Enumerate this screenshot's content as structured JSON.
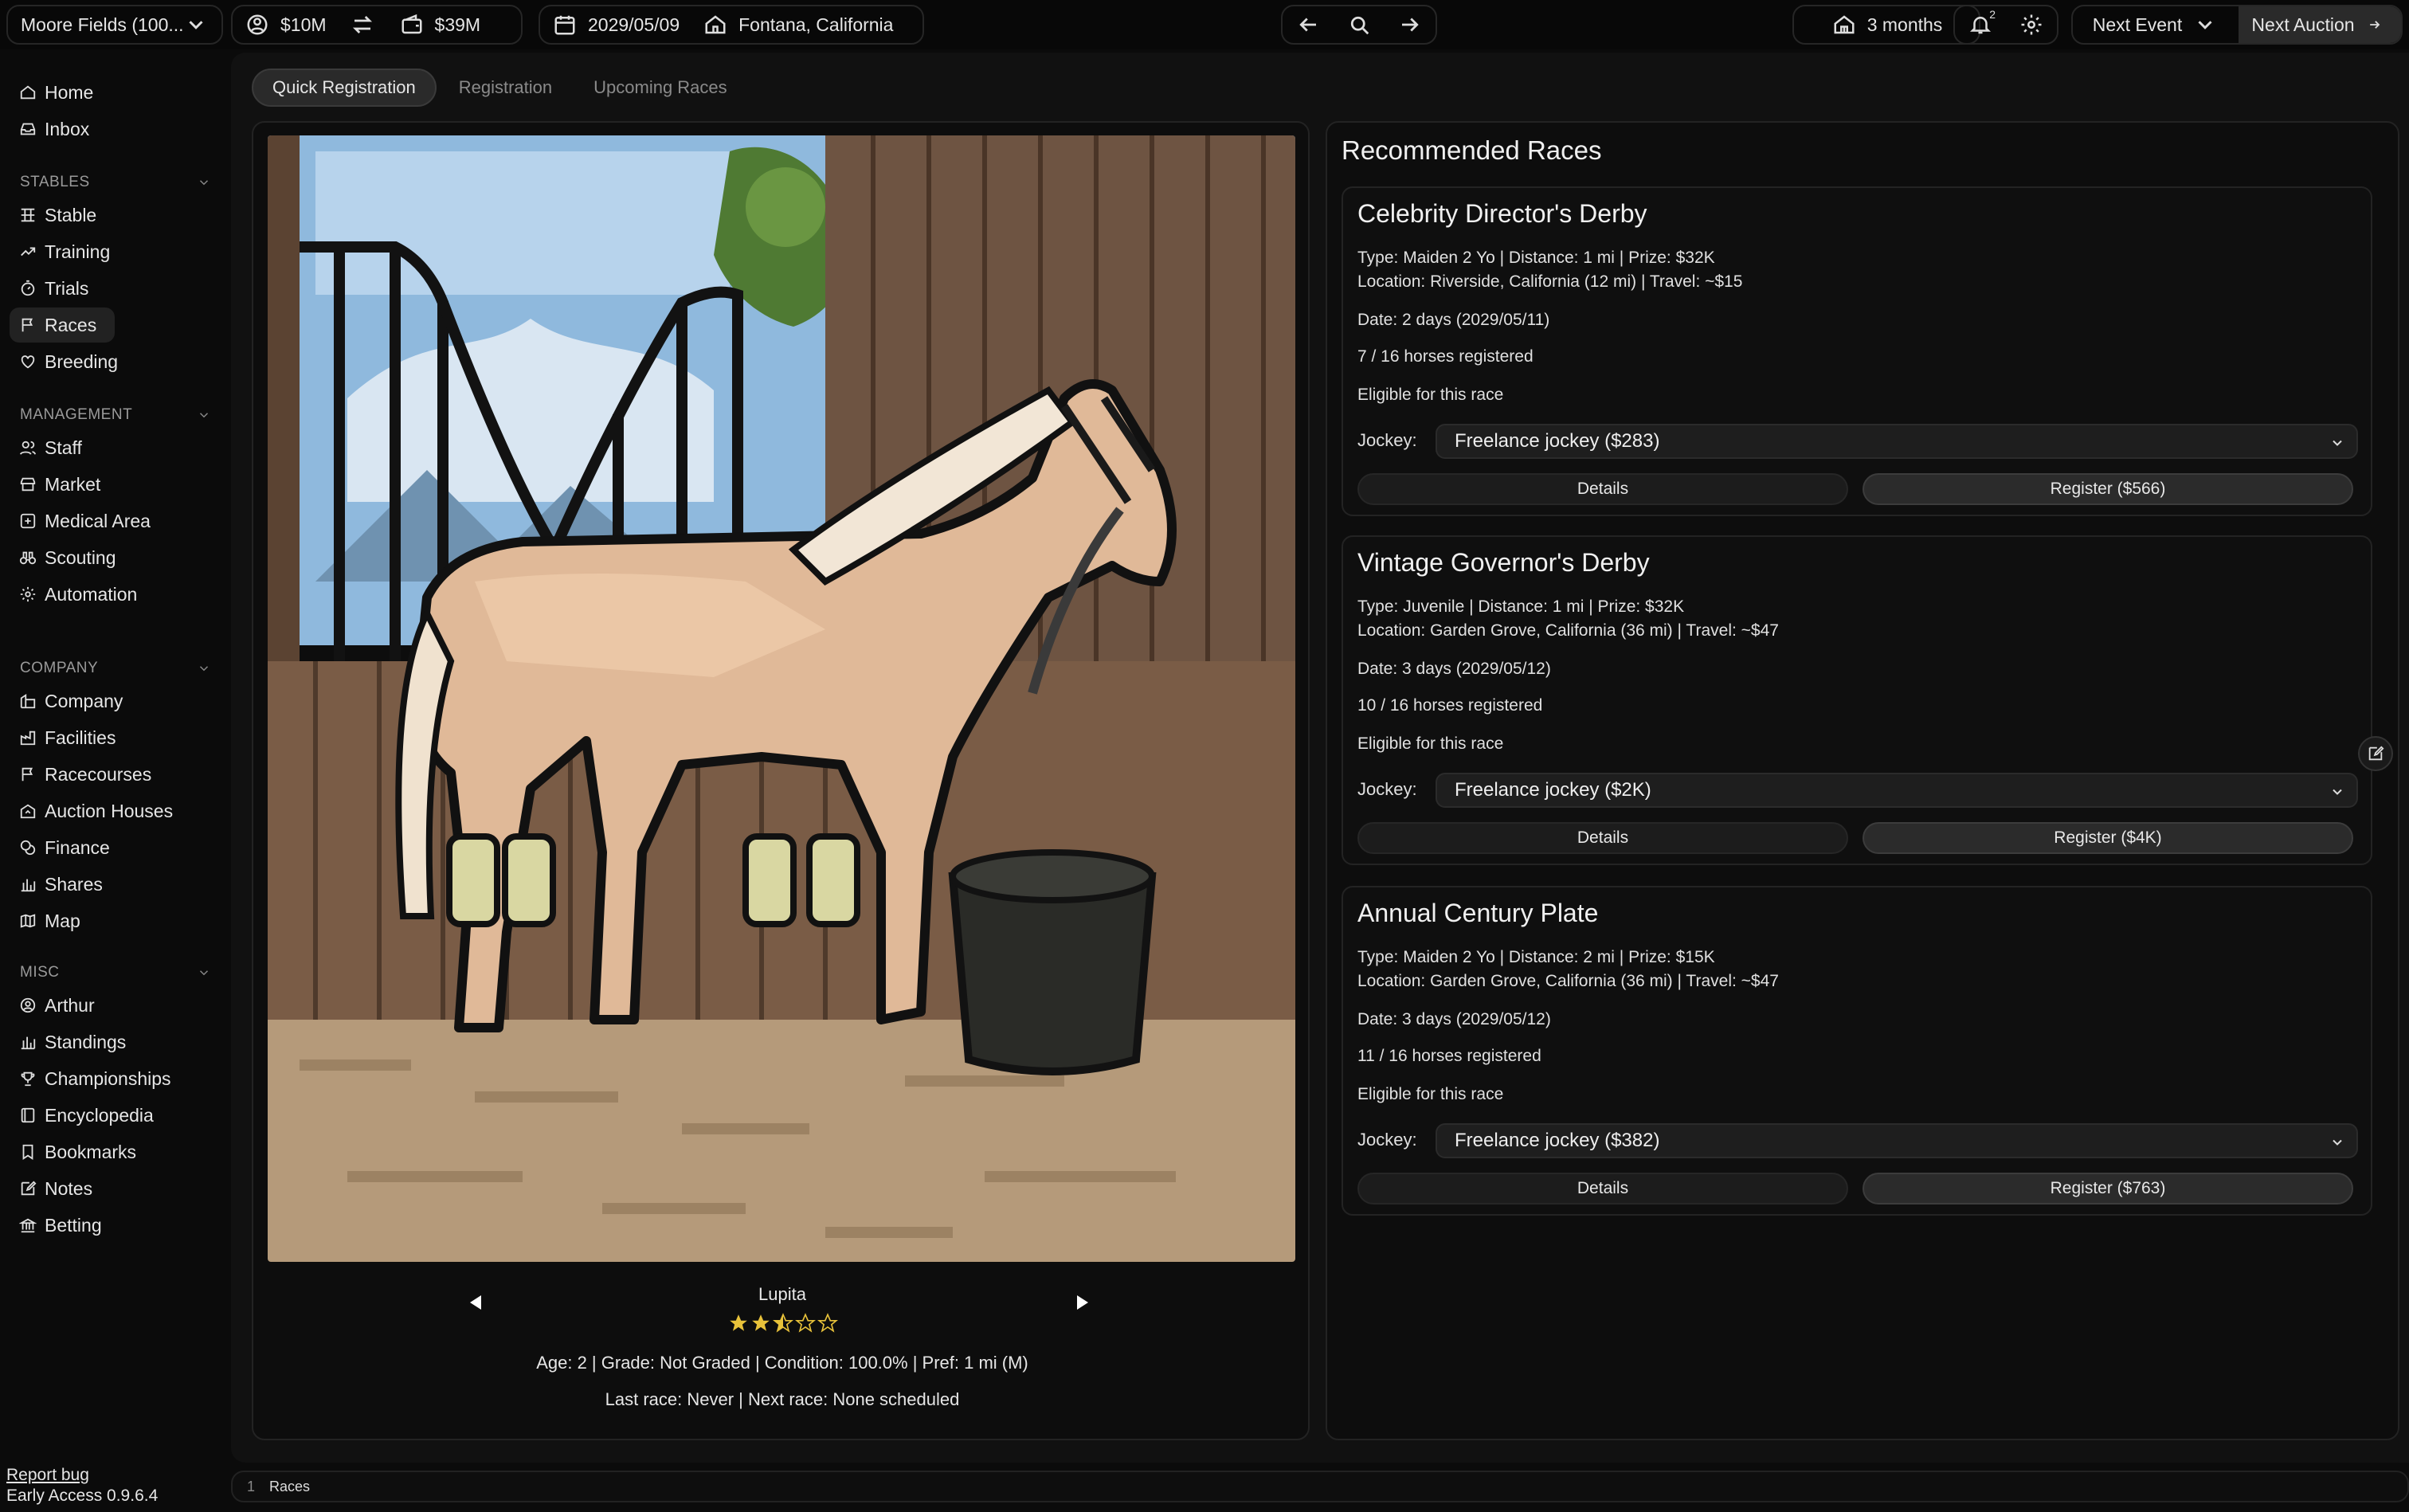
{
  "topbar": {
    "stable_name": "Moore Fields (100...",
    "cash": "$10M",
    "net_worth": "$39M",
    "date": "2029/05/09",
    "location": "Fontana, California",
    "horizon": "3 months",
    "notif_count": "2",
    "next_event": "Next Event",
    "next_auction": "Next Auction"
  },
  "sidebar": {
    "items_top": [
      {
        "label": "Home",
        "icon": "home-icon"
      },
      {
        "label": "Inbox",
        "icon": "inbox-icon"
      }
    ],
    "sections": [
      {
        "title": "STABLES",
        "items": [
          "Stable",
          "Training",
          "Trials",
          "Races",
          "Breeding"
        ]
      },
      {
        "title": "MANAGEMENT",
        "items": [
          "Staff",
          "Market",
          "Medical Area",
          "Scouting",
          "Automation"
        ]
      },
      {
        "title": "COMPANY",
        "items": [
          "Company",
          "Facilities",
          "Racecourses",
          "Auction Houses",
          "Finance",
          "Shares",
          "Map"
        ]
      },
      {
        "title": "MISC",
        "items": [
          "Arthur",
          "Standings",
          "Championships",
          "Encyclopedia",
          "Bookmarks",
          "Notes",
          "Betting"
        ]
      }
    ],
    "active": "Races",
    "report_bug": "Report bug",
    "version": "Early Access 0.9.6.4"
  },
  "tabs": [
    "Quick Registration",
    "Registration",
    "Upcoming Races"
  ],
  "horse": {
    "name": "Lupita",
    "rating": 2.5,
    "stats": "Age: 2 | Grade: Not Graded | Condition: 100.0% | Pref: 1 mi (M)",
    "races": "Last race: Never | Next race: None scheduled"
  },
  "recommended": {
    "title": "Recommended Races",
    "races": [
      {
        "name": "Celebrity Director's Derby",
        "type_line": "Type: Maiden 2 Yo | Distance: 1 mi | Prize: $32K",
        "location_line": "Location: Riverside, California (12 mi) | Travel: ~$15",
        "date_line": "Date: 2 days (2029/05/11)",
        "registered_line": "7 / 16 horses registered",
        "eligible_line": "Eligible for this race",
        "jockey_label": "Jockey:",
        "jockey": "Freelance jockey ($283)",
        "details": "Details",
        "register": "Register ($566)"
      },
      {
        "name": "Vintage Governor's Derby",
        "type_line": "Type: Juvenile | Distance: 1 mi | Prize: $32K",
        "location_line": "Location: Garden Grove, California (36 mi) | Travel: ~$47",
        "date_line": "Date: 3 days (2029/05/12)",
        "registered_line": "10 / 16 horses registered",
        "eligible_line": "Eligible for this race",
        "jockey_label": "Jockey:",
        "jockey": "Freelance jockey ($2K)",
        "details": "Details",
        "register": "Register ($4K)"
      },
      {
        "name": "Annual Century Plate",
        "type_line": "Type: Maiden 2 Yo | Distance: 2 mi | Prize: $15K",
        "location_line": "Location: Garden Grove, California (36 mi) | Travel: ~$47",
        "date_line": "Date: 3 days (2029/05/12)",
        "registered_line": "11 / 16 horses registered",
        "eligible_line": "Eligible for this race",
        "jockey_label": "Jockey:",
        "jockey": "Freelance jockey ($382)",
        "details": "Details",
        "register": "Register ($763)"
      }
    ]
  },
  "footer": {
    "number": "1",
    "crumb": "Races"
  },
  "colors": {
    "background": "#0b0b0b",
    "panel": "#111111",
    "card": "#0f0f0f",
    "star": "#e8c23a"
  }
}
